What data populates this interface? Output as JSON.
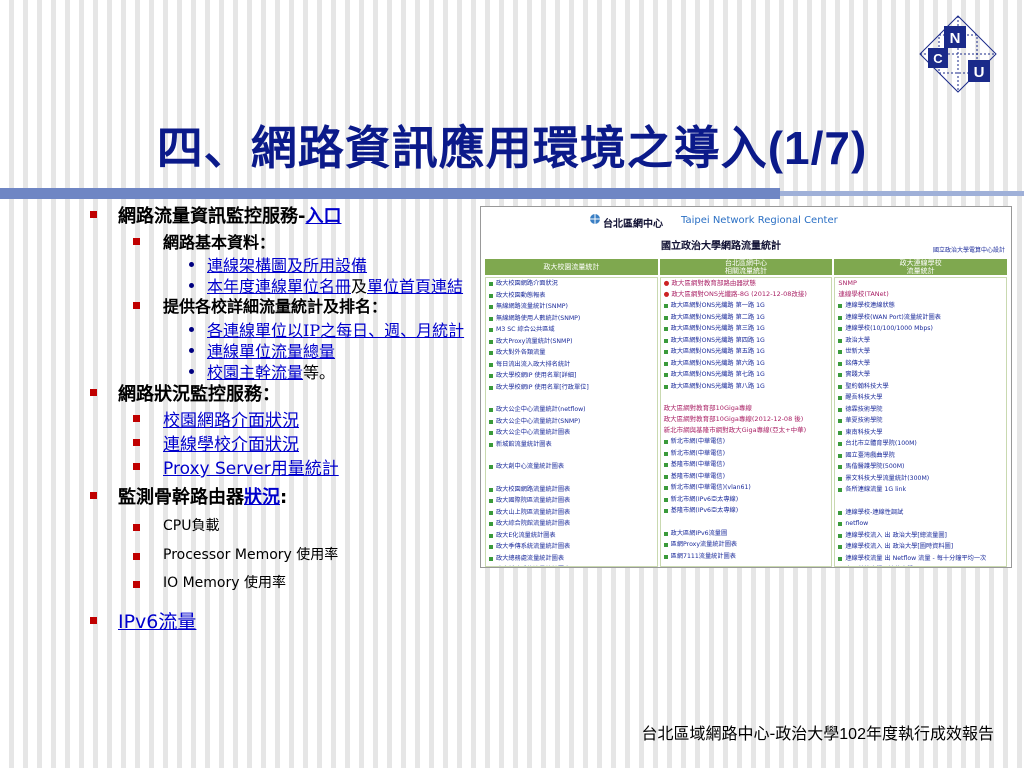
{
  "title": {
    "main": "四、網路資訊應用環境之導入",
    "suffix": "(1/7)"
  },
  "logo": {
    "letters": [
      "N",
      "C",
      "U"
    ]
  },
  "outline": {
    "item1": {
      "label": "網路流量資訊監控服務-",
      "link": "入口"
    },
    "item1_sub1": {
      "label": "網路基本資料："
    },
    "item1_sub1_links": {
      "a": "連線架構圖及所用設備",
      "b": "本年度連線單位名冊",
      "and": "及",
      "c": "單位首頁連結"
    },
    "item1_sub2": {
      "label": "提供各校詳細流量統計及排名："
    },
    "item1_sub2_links": {
      "a": "各連線單位以IP之每日、週、月統計",
      "b": "連線單位流量總量",
      "c": "校園主幹流量",
      "c_suffix": "等。"
    },
    "item2": {
      "label": "網路狀況監控服務："
    },
    "item2_subs": [
      "校園網路介面狀況",
      "連線學校介面狀況",
      "Proxy Server用量統計"
    ],
    "item3": {
      "label": "監測骨幹路由器",
      "link": "狀況",
      "colon": ":"
    },
    "item3_subs": [
      "CPU負載",
      "Processor Memory 使用率",
      "IO Memory 使用率"
    ],
    "item4": {
      "link": "IPv6流量"
    }
  },
  "screenshot": {
    "org": "台北區網中心",
    "eng": "Taipei Network Regional Center",
    "subtitle": "國立政治大學網路流量統計",
    "note": "國立政治大學電算中心設計",
    "col_headers": [
      "政大校園流量統計",
      "台北區網中心\n相關流量統計",
      "政大連線學校\n流量統計"
    ],
    "col1": [
      "政大校園網路介面狀況",
      "政大校園動態報表",
      "無線網路流量統計(SNMP)",
      "無線網路使用人數統計(SNMP)",
      "M3  SC  綜合公共區域",
      "政大Proxy流量統計(SNMP)",
      "政大對外各類流量",
      "每日流出流入政大排名統計",
      "政大學校網IP 使用名單[詳細]",
      "政大學校網IP 使用名單[行政單位]",
      "",
      "政大公企中心流量統計(netflow)",
      "政大公企中心流量統計(SNMP)",
      "政大公企中心流量統計圖表",
      "新城館流量統計圖表",
      "",
      "政大創中心流量統計圖表",
      "",
      "政大校園網路流量統計圖表",
      "政大國際院區流量統計圖表",
      "政大山上院區流量統計圖表",
      "政大綜合院館流量統計圖表",
      "政大E化流量統計圖表",
      "政大季傳系統流量統計圖表",
      "政大總務處流量統計圖表",
      "政大新建系統流量統計圖表",
      "",
      "政大莊敬內外流量統計圖表",
      "政大莊敬外外流量統計圖表",
      "政大莊敬九舍流量統計圖表",
      "政大莊敬ABC舍流量統計圖表",
      "政大自強五至八舍流量統計圖表"
    ],
    "col2_top": [
      "政大區網對教育部路由器狀態",
      "政大區網對ONS光纖路-8G (2012-12-08改接)"
    ],
    "col2": [
      "政大區網對ONS光纖路 第一路 1G",
      "政大區網對ONS光纖路 第二路 1G",
      "政大區網對ONS光纖路 第三路 1G",
      "政大區網對ONS光纖路 第四路 1G",
      "政大區網對ONS光纖路 第五路 1G",
      "政大區網對ONS光纖路 第六路 1G",
      "政大區網對ONS光纖路 第七路 1G",
      "政大區網對ONS光纖路 第八路 1G"
    ],
    "col2_mid": [
      "政大區網對教育部10Giga專線",
      "政大區網對教育部10Giga專線(2012-12-08 後)",
      "新北市網與基隆市網對政大Giga專線(亞太+中華)"
    ],
    "col2_b": [
      "新北市網(中華電信)",
      "新北市網(中華電信)",
      "基隆市網(中華電信)",
      "基隆市網(中華電信)",
      "新北市網(中華電信)(vlan61)",
      "新北市網(IPv6亞太專線)",
      "基隆市網(IPv6亞太專線)"
    ],
    "col2_c": [
      "政大區網IPv6流量圖",
      "區網Proxy流量統計圖表",
      "區網7111流量統計圖表"
    ],
    "col3_head": [
      "SNMP",
      "連線學校(TANet)"
    ],
    "col3": [
      "連線學校連線狀態",
      "連線學校(WAN Port)流量統計圖表",
      "連線學校(10/100/1000 Mbps)",
      "政治大學",
      "世新大學",
      "銘傳大學",
      "實踐大學",
      "聖約翰科技大學",
      "醒吾科技大學",
      "德霖技術學院",
      "華夏技術學院",
      "東南科技大學",
      "台北市立體育學院(100M)",
      "國立臺灣戲曲學院",
      "馬偕醫護學院(500M)",
      "景文科技大學流量統計(300M)",
      "各所連線流量 1G link",
      "",
      "連線學校-連線性調試",
      "netflow",
      "連線學校流入 出 政治大學[總流量圖]",
      "連線學校流入 出 政治大學[圖時資料圖]",
      "連線學校流量 出 Netflow 流量 - 每十分鐘平均一次",
      "中國科技大學 | 清華大學",
      "東南科技大學 | 城市大學",
      "景文高工 | 開平高中",
      "華夏大學 | 泰北高中",
      "東南科技大學 | 景文高工",
      "台北醒吾學院 | 徐匯高中"
    ],
    "col3_right": [
      "新北科技大學",
      "聖約翰科技大學",
      "國立台北教育大學",
      "",
      "",
      "",
      "",
      "中興中學",
      ""
    ]
  },
  "footer": {
    "left": "台北區域網路中心-政治大學",
    "num": "102",
    "right": "年度執行成效報告"
  }
}
